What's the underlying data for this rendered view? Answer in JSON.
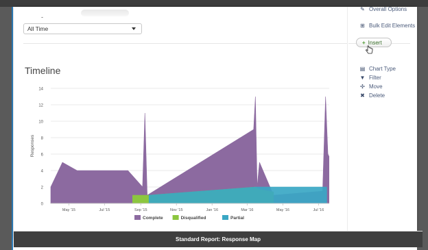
{
  "filter": {
    "date_range_value": "All Time",
    "dash": "-"
  },
  "actions": {
    "overall_options_label": "Overall Options",
    "bulk_edit_label": "Bulk Edit Elements",
    "insert_label": "Insert"
  },
  "chart_menu": {
    "items": [
      {
        "label": "Chart Type",
        "icon": "bar-chart-icon"
      },
      {
        "label": "Filter",
        "icon": "filter-icon"
      },
      {
        "label": "Move",
        "icon": "move-icon"
      },
      {
        "label": "Delete",
        "icon": "delete-icon"
      }
    ]
  },
  "chart_title": "Timeline",
  "footer": {
    "title": "Standard Report: Response Map"
  },
  "colors": {
    "complete": "#8c6aa0",
    "disqualified": "#8cc63f",
    "partial": "#3aa7c4"
  },
  "chart_data": {
    "type": "area",
    "title": "Timeline",
    "ylabel": "Responses",
    "xlabel": "",
    "ylim": [
      0,
      14
    ],
    "yticks": [
      0,
      2,
      4,
      6,
      8,
      10,
      12,
      14
    ],
    "xticks": [
      "May '15",
      "Jul '15",
      "Sep '15",
      "Nov '15",
      "Jan '16",
      "Mar '16",
      "May '16",
      "Jul '16"
    ],
    "grid": true,
    "legend": "bottom",
    "series": [
      {
        "name": "Complete",
        "points": [
          [
            "2015-03-31",
            2
          ],
          [
            "2015-04-20",
            5
          ],
          [
            "2015-05-15",
            4
          ],
          [
            "2015-06-30",
            4
          ],
          [
            "2015-08-10",
            4
          ],
          [
            "2015-09-04",
            2
          ],
          [
            "2015-09-08",
            11
          ],
          [
            "2015-09-12",
            1
          ],
          [
            "2016-03-12",
            9
          ],
          [
            "2016-03-15",
            13
          ],
          [
            "2016-03-18",
            2
          ],
          [
            "2016-03-22",
            5
          ],
          [
            "2016-04-15",
            1
          ],
          [
            "2016-07-08",
            1.5
          ],
          [
            "2016-07-13",
            13
          ],
          [
            "2016-07-17",
            6
          ],
          [
            "2016-07-31",
            4
          ]
        ]
      },
      {
        "name": "Disqualified",
        "points": [
          [
            "2015-08-18",
            1
          ],
          [
            "2015-09-15",
            1
          ],
          [
            "2016-03-15",
            2
          ],
          [
            "2016-03-22",
            1.7
          ],
          [
            "2016-04-15",
            1.4
          ]
        ]
      },
      {
        "name": "Partial",
        "points": [
          [
            "2015-09-15",
            1
          ],
          [
            "2016-03-15",
            2
          ],
          [
            "2016-07-15",
            2
          ]
        ]
      }
    ]
  }
}
